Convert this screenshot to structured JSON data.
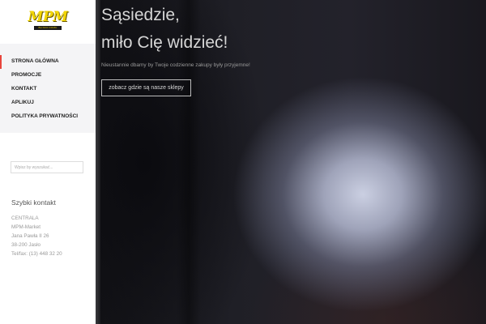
{
  "logo": {
    "text": "MPM",
    "tagline": "BLISKO DOMU"
  },
  "nav": {
    "items": [
      {
        "label": "STRONA GŁÓWNA",
        "active": true
      },
      {
        "label": "PROMOCJE",
        "active": false
      },
      {
        "label": "KONTAKT",
        "active": false
      },
      {
        "label": "APLIKUJ",
        "active": false
      },
      {
        "label": "POLITYKA PRYWATNOŚCI",
        "active": false
      }
    ]
  },
  "search": {
    "placeholder": "Wpisz by wyszukać...",
    "value": ""
  },
  "quick_contact": {
    "title": "Szybki kontakt",
    "lines": [
      "CENTRALA",
      "MPM-Market",
      "Jana Pawła II 26",
      "38-200 Jasło",
      "Tel/fax: (13) 448 32 20"
    ]
  },
  "hero": {
    "heading_line1": "Sąsiedzie,",
    "heading_line2": "miło Cię widzieć!",
    "subtitle": "Nieustannie dbamy by Twoje codzienne zakupy były przyjemne!",
    "cta_label": "zobacz gdzie są nasze sklepy"
  },
  "colors": {
    "accent": "#e8453c",
    "logo_yellow": "#f2d500",
    "nav_bg": "#f4f4f6"
  }
}
